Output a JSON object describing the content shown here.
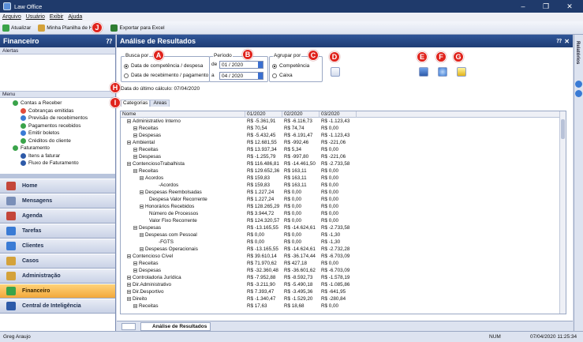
{
  "window": {
    "title": "Law Office"
  },
  "menu": [
    "Arquivo",
    "Usuário",
    "Exibir",
    "Ajuda"
  ],
  "toolbar": {
    "refresh": "Atualizar",
    "spreadsheet": "Minha Planilha de H",
    "export": "Exportar para Excel"
  },
  "left": {
    "title": "Financeiro",
    "alerts": "Alertas",
    "menu_label": "Menu",
    "tree": [
      {
        "label": "Contas a Receber",
        "level": 0,
        "color": "#3aa34a"
      },
      {
        "label": "Cobranças emitidas",
        "level": 1,
        "color": "#e24c3c"
      },
      {
        "label": "Previsão de recebimentos",
        "level": 1,
        "color": "#3a7bd5"
      },
      {
        "label": "Pagamentos recebidos",
        "level": 1,
        "color": "#3aa34a"
      },
      {
        "label": "Emitir boletos",
        "level": 1,
        "color": "#3a7bd5"
      },
      {
        "label": "Créditos do cliente",
        "level": 1,
        "color": "#3aa34a"
      },
      {
        "label": "Faturamento",
        "level": 0,
        "color": "#3aa34a"
      },
      {
        "label": "Itens a faturar",
        "level": 1,
        "color": "#2d5aa8"
      },
      {
        "label": "Fluxo de Faturamento",
        "level": 1,
        "color": "#2d5aa8"
      }
    ],
    "nav": [
      {
        "label": "Home",
        "color": "#c4463a",
        "active": false
      },
      {
        "label": "Mensagens",
        "color": "#7a8fb8",
        "active": false
      },
      {
        "label": "Agenda",
        "color": "#c4463a",
        "active": false
      },
      {
        "label": "Tarefas",
        "color": "#3a7bd5",
        "active": false
      },
      {
        "label": "Clientes",
        "color": "#3a7bd5",
        "active": false
      },
      {
        "label": "Casos",
        "color": "#d4a23a",
        "active": false
      },
      {
        "label": "Administração",
        "color": "#d4a23a",
        "active": false
      },
      {
        "label": "Financeiro",
        "color": "#3aa34a",
        "active": true
      },
      {
        "label": "Central de Inteligência",
        "color": "#2d5aa8",
        "active": false
      }
    ]
  },
  "main": {
    "title": "Análise de Resultados",
    "busca": {
      "label": "Busca por",
      "opt1": "Data de competência / despesa",
      "opt2": "Data de recebimento / pagamento"
    },
    "periodo": {
      "label": "Período",
      "de": "de",
      "a": "a",
      "from": "01 / 2020",
      "to": "04 / 2020"
    },
    "agrupar": {
      "label": "Agrupar por",
      "opt1": "Competência",
      "opt2": "Caixa"
    },
    "last_calc": "Data do último cálculo: 07/04/2020",
    "tabs": [
      "Categorias",
      "Areas"
    ],
    "columns": [
      "Nome",
      "01/2020",
      "02/2020",
      "03/2020"
    ],
    "rows": [
      {
        "n": "Administrativo Interno",
        "l": 0,
        "v": [
          "R$ -5.361,91",
          "R$ -6.116,73",
          "R$ -1.123,43"
        ]
      },
      {
        "n": "Receitas",
        "l": 1,
        "v": [
          "R$ 70,54",
          "R$ 74,74",
          "R$ 0,00"
        ]
      },
      {
        "n": "Despesas",
        "l": 1,
        "v": [
          "R$ -5.432,45",
          "R$ -6.191,47",
          "R$ -1.123,43"
        ]
      },
      {
        "n": "Ambiental",
        "l": 0,
        "v": [
          "R$ 12.681,55",
          "R$ -992,46",
          "R$ -221,06"
        ]
      },
      {
        "n": "Receitas",
        "l": 1,
        "v": [
          "R$ 13.937,34",
          "R$ 5,34",
          "R$ 0,00"
        ]
      },
      {
        "n": "Despesas",
        "l": 1,
        "v": [
          "R$ -1.255,79",
          "R$ -997,80",
          "R$ -221,06"
        ]
      },
      {
        "n": "ContenciosoTrabalhista",
        "l": 0,
        "v": [
          "R$ 116.486,81",
          "R$ -14.461,50",
          "R$ -2.733,58"
        ]
      },
      {
        "n": "Receitas",
        "l": 1,
        "v": [
          "R$ 129.652,36",
          "R$ 163,11",
          "R$ 0,00"
        ]
      },
      {
        "n": "Acordos",
        "l": 2,
        "v": [
          "R$ 159,83",
          "R$ 163,11",
          "R$ 0,00"
        ]
      },
      {
        "n": "-Acordos",
        "l": 4,
        "v": [
          "R$ 159,83",
          "R$ 163,11",
          "R$ 0,00"
        ]
      },
      {
        "n": "Despesas Reembolsadas",
        "l": 2,
        "v": [
          "R$ 1.227,24",
          "R$ 0,00",
          "R$ 0,00"
        ]
      },
      {
        "n": "Despesa Valor Recorrente",
        "l": 3,
        "v": [
          "R$ 1.227,24",
          "R$ 0,00",
          "R$ 0,00"
        ]
      },
      {
        "n": "Honorários Recebidos",
        "l": 2,
        "v": [
          "R$ 128.265,29",
          "R$ 0,00",
          "R$ 0,00"
        ]
      },
      {
        "n": "Número de Processos",
        "l": 3,
        "v": [
          "R$ 3.944,72",
          "R$ 0,00",
          "R$ 0,00"
        ]
      },
      {
        "n": "Valor Fixo Recorrente",
        "l": 3,
        "v": [
          "R$ 124.320,57",
          "R$ 0,00",
          "R$ 0,00"
        ]
      },
      {
        "n": "Despesas",
        "l": 1,
        "v": [
          "R$ -13.165,55",
          "R$ -14.624,61",
          "R$ -2.733,58"
        ]
      },
      {
        "n": "Despesas com Pessoal",
        "l": 2,
        "v": [
          "R$ 0,00",
          "R$ 0,00",
          "R$ -1,30"
        ]
      },
      {
        "n": "-FGTS",
        "l": 4,
        "v": [
          "R$ 0,00",
          "R$ 0,00",
          "R$ -1,30"
        ]
      },
      {
        "n": "Despesas Operacionais",
        "l": 2,
        "v": [
          "R$ -13.165,55",
          "R$ -14.624,61",
          "R$ -2.732,28"
        ]
      },
      {
        "n": "Contencioso Cível",
        "l": 0,
        "v": [
          "R$ 39.610,14",
          "R$ -36.174,44",
          "R$ -6.703,09"
        ]
      },
      {
        "n": "Receitas",
        "l": 1,
        "v": [
          "R$ 71.970,62",
          "R$ 427,18",
          "R$ 0,00"
        ]
      },
      {
        "n": "Despesas",
        "l": 1,
        "v": [
          "R$ -32.360,48",
          "R$ -36.601,62",
          "R$ -6.703,09"
        ]
      },
      {
        "n": "Controladoria Jurídica",
        "l": 0,
        "v": [
          "R$ -7.952,88",
          "R$ -8.592,73",
          "R$ -1.578,19"
        ]
      },
      {
        "n": "Dir.Administrativo",
        "l": 0,
        "v": [
          "R$ -3.211,90",
          "R$ -5.490,18",
          "R$ -1.085,86"
        ]
      },
      {
        "n": "Dir.Desportivo",
        "l": 0,
        "v": [
          "R$ 7.393,47",
          "R$ -3.495,36",
          "R$ -641,95"
        ]
      },
      {
        "n": "Direito",
        "l": 0,
        "v": [
          "R$ -1.340,47",
          "R$ -1.529,20",
          "R$ -280,84"
        ]
      },
      {
        "n": "Receitas",
        "l": 1,
        "v": [
          "R$ 17,63",
          "R$ 18,68",
          "R$ 0,00"
        ]
      }
    ],
    "bottom_tab": "Análise de Resultados"
  },
  "right_strip": "Relatórios",
  "status": {
    "user": "Greg Araujo",
    "num": "NUM",
    "datetime": "07/04/2020 11:25:34"
  },
  "badges": [
    "A",
    "B",
    "C",
    "D",
    "E",
    "F",
    "G",
    "H",
    "I",
    "J"
  ]
}
